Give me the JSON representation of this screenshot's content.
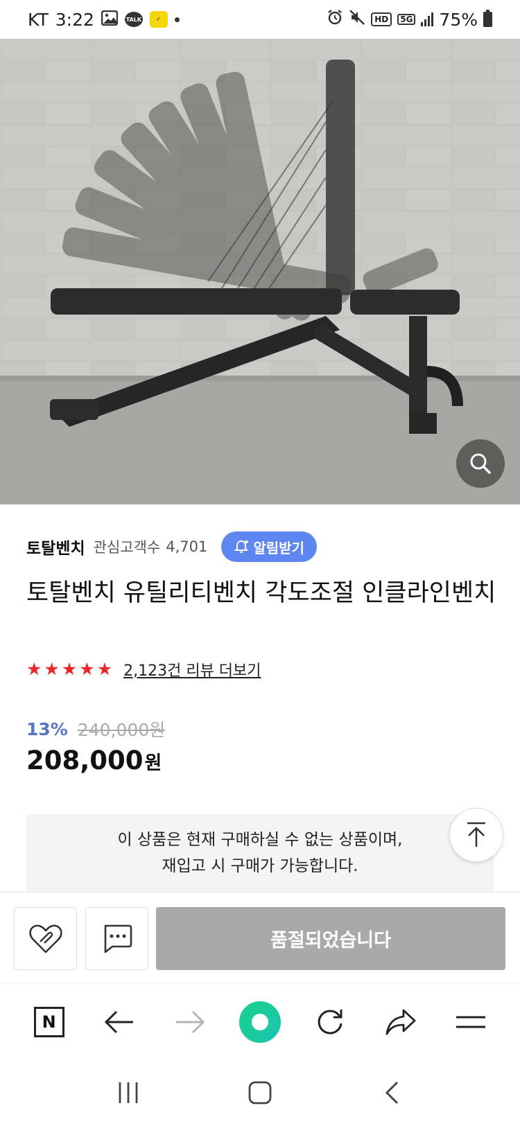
{
  "status_bar": {
    "carrier": "KT",
    "time": "3:22",
    "talk_label": "TALK",
    "hd_label": "HD",
    "network_label": "5G",
    "battery": "75%"
  },
  "product": {
    "brand": "토탈벤치",
    "fan_label": "관심고객수",
    "fan_count": "4,701",
    "alarm_button": "알림받기",
    "title": "토탈벤치 유틸리티벤치 각도조절 인클라인벤치",
    "rating_stars": 5,
    "review_link": "2,123건 리뷰 더보기",
    "discount_rate": "13%",
    "original_price": "240,000원",
    "final_price": "208,000",
    "currency": "원",
    "notice_line1": "이 상품은 현재 구매하실 수 없는 상품이며,",
    "notice_line2": "재입고 시 구매가 가능합니다."
  },
  "actions": {
    "soldout_label": "품절되었습니다"
  },
  "browser_nav": {
    "home_label": "N"
  },
  "colors": {
    "alarm_button": "#5e86f0",
    "discount": "#5577c8",
    "star": "#e8282b",
    "soldout_button": "#a9a9a9",
    "green_button": "#19d38a"
  }
}
